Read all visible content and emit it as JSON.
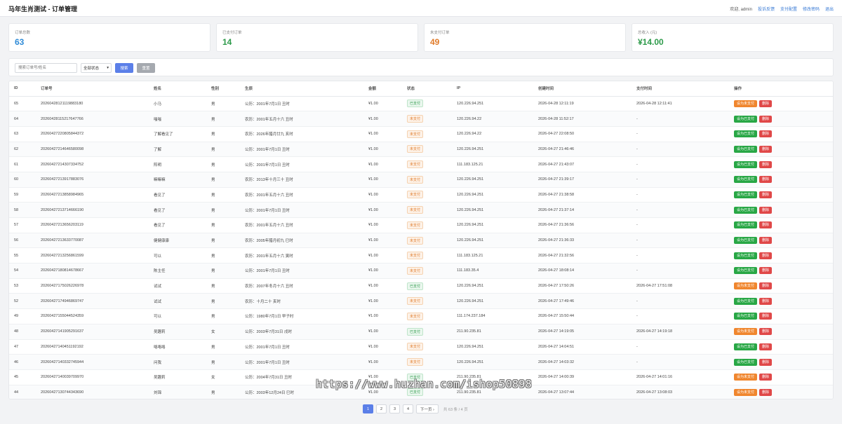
{
  "header": {
    "title": "马年生肖测试 - 订单管理",
    "welcome": "欢迎, admin",
    "links": [
      "投诉反馈",
      "支付配置",
      "修改密码",
      "退出"
    ]
  },
  "stats": [
    {
      "label": "订单总数",
      "value": "63",
      "color": "#2f8bd7"
    },
    {
      "label": "已支付订单",
      "value": "14",
      "color": "#2d9a4a"
    },
    {
      "label": "未支付订单",
      "value": "49",
      "color": "#e07b2a"
    },
    {
      "label": "总收入 (元)",
      "value": "¥14.00",
      "color": "#2d9a4a"
    }
  ],
  "filter": {
    "search_placeholder": "搜索订单号/姓名",
    "status_value": "全部状态",
    "search_label": "搜索",
    "reset_label": "重置"
  },
  "table": {
    "columns": [
      "ID",
      "订单号",
      "姓名",
      "性别",
      "生辰",
      "金额",
      "状态",
      "IP",
      "创建时间",
      "支付时间",
      "操作"
    ],
    "rows": [
      {
        "id": "65",
        "order": "20260428121119883180",
        "name": "小马",
        "gender": "男",
        "birth": "公历：2001年7月1日 丑时",
        "amount": "¥1.00",
        "status": "已支付",
        "paid": true,
        "ip": "120.226.94.251",
        "created": "2026-04-28 12:11:19",
        "paytime": "2026-04-28 12:11:41",
        "action": "设为未支付",
        "del": "删除"
      },
      {
        "id": "64",
        "order": "20260428115217647766",
        "name": "嗤嗤",
        "gender": "男",
        "birth": "农历：2001年五月十六 丑时",
        "amount": "¥1.00",
        "status": "未支付",
        "paid": false,
        "ip": "120.226.94.22",
        "created": "2026-04-28 11:52:17",
        "paytime": "-",
        "action": "设为已支付",
        "del": "删除"
      },
      {
        "id": "63",
        "order": "20260427220805844372",
        "name": "了解看见了",
        "gender": "男",
        "birth": "农历：2026年腊月廿九 亥时",
        "amount": "¥1.00",
        "status": "未支付",
        "paid": false,
        "ip": "120.226.94.22",
        "created": "2026-04-27 22:08:50",
        "paytime": "-",
        "action": "设为已支付",
        "del": "删除"
      },
      {
        "id": "62",
        "order": "20260427214646580098",
        "name": "了解",
        "gender": "男",
        "birth": "公历：2001年7月1日 丑时",
        "amount": "¥1.00",
        "status": "未支付",
        "paid": false,
        "ip": "120.226.94.251",
        "created": "2026-04-27 21:46:46",
        "paytime": "-",
        "action": "设为已支付",
        "del": "删除"
      },
      {
        "id": "61",
        "order": "20260427214307334752",
        "name": "阵明",
        "gender": "男",
        "birth": "公历：2001年7月1日 丑时",
        "amount": "¥1.00",
        "status": "未支付",
        "paid": false,
        "ip": "111.183.125.21",
        "created": "2026-04-27 21:43:07",
        "paytime": "-",
        "action": "设为已支付",
        "del": "删除"
      },
      {
        "id": "60",
        "order": "20260427213917883076",
        "name": "嘛嘛嘛",
        "gender": "男",
        "birth": "农历：2013年十月三十 丑时",
        "amount": "¥1.00",
        "status": "未支付",
        "paid": false,
        "ip": "120.226.94.251",
        "created": "2026-04-27 21:39:17",
        "paytime": "-",
        "action": "设为已支付",
        "del": "删除"
      },
      {
        "id": "59",
        "order": "20260427213858984965",
        "name": "看见了",
        "gender": "男",
        "birth": "农历：2001年五月十六 丑时",
        "amount": "¥1.00",
        "status": "未支付",
        "paid": false,
        "ip": "120.226.94.251",
        "created": "2026-04-27 21:38:58",
        "paytime": "-",
        "action": "设为已支付",
        "del": "删除"
      },
      {
        "id": "58",
        "order": "20260427213714666190",
        "name": "看见了",
        "gender": "男",
        "birth": "公历：2001年7月1日 丑时",
        "amount": "¥1.00",
        "status": "未支付",
        "paid": false,
        "ip": "120.226.94.251",
        "created": "2026-04-27 21:37:14",
        "paytime": "-",
        "action": "设为已支付",
        "del": "删除"
      },
      {
        "id": "57",
        "order": "20260427213656203119",
        "name": "看见了",
        "gender": "男",
        "birth": "农历：2001年五月十六 丑时",
        "amount": "¥1.00",
        "status": "未支付",
        "paid": false,
        "ip": "120.226.94.251",
        "created": "2026-04-27 21:36:56",
        "paytime": "-",
        "action": "设为已支付",
        "del": "删除"
      },
      {
        "id": "56",
        "order": "20260427213633770087",
        "name": "健健康康",
        "gender": "男",
        "birth": "农历：2005年腊月初九 巳时",
        "amount": "¥1.00",
        "status": "未支付",
        "paid": false,
        "ip": "120.226.94.251",
        "created": "2026-04-27 21:36:33",
        "paytime": "-",
        "action": "设为已支付",
        "del": "删除"
      },
      {
        "id": "55",
        "order": "20260427213256861599",
        "name": "可以",
        "gender": "男",
        "birth": "农历：2001年五月十六 寅时",
        "amount": "¥1.00",
        "status": "未支付",
        "paid": false,
        "ip": "111.183.125.21",
        "created": "2026-04-27 21:32:56",
        "paytime": "-",
        "action": "设为已支付",
        "del": "删除"
      },
      {
        "id": "54",
        "order": "20260427180814678667",
        "name": "陈主任",
        "gender": "男",
        "birth": "公历：2001年7月1日 丑时",
        "amount": "¥1.00",
        "status": "未支付",
        "paid": false,
        "ip": "111.183.35.4",
        "created": "2026-04-27 18:08:14",
        "paytime": "-",
        "action": "设为已支付",
        "del": "删除"
      },
      {
        "id": "53",
        "order": "20260427175026226978",
        "name": "试试",
        "gender": "男",
        "birth": "农历：2007年冬月十六 丑时",
        "amount": "¥1.00",
        "status": "已支付",
        "paid": true,
        "ip": "120.226.94.251",
        "created": "2026-04-27 17:50:26",
        "paytime": "2026-04-27 17:51:08",
        "action": "设为未支付",
        "del": "删除"
      },
      {
        "id": "52",
        "order": "20260427174946869747",
        "name": "试试",
        "gender": "男",
        "birth": "农历：十月二十 亥时",
        "amount": "¥1.00",
        "status": "未支付",
        "paid": false,
        "ip": "120.226.94.251",
        "created": "2026-04-27 17:49:46",
        "paytime": "-",
        "action": "设为已支付",
        "del": "删除"
      },
      {
        "id": "49",
        "order": "20260427155044524359",
        "name": "可以",
        "gender": "男",
        "birth": "公历：1980年7月1日 早子时",
        "amount": "¥1.00",
        "status": "未支付",
        "paid": false,
        "ip": "111.174.237.184",
        "created": "2026-04-27 15:50:44",
        "paytime": "-",
        "action": "设为已支付",
        "del": "删除"
      },
      {
        "id": "48",
        "order": "20260427141905291637",
        "name": "吴趣莉",
        "gender": "女",
        "birth": "公历：2003年7月31日 戌时",
        "amount": "¥1.00",
        "status": "已支付",
        "paid": true,
        "ip": "211.90.235.81",
        "created": "2026-04-27 14:19:05",
        "paytime": "2026-04-27 14:19:18",
        "action": "设为未支付",
        "del": "删除"
      },
      {
        "id": "47",
        "order": "20260427140451192192",
        "name": "咯咯咯",
        "gender": "男",
        "birth": "公历：2001年7月1日 丑时",
        "amount": "¥1.00",
        "status": "未支付",
        "paid": false,
        "ip": "120.226.94.251",
        "created": "2026-04-27 14:04:51",
        "paytime": "-",
        "action": "设为已支付",
        "del": "删除"
      },
      {
        "id": "46",
        "order": "20260427140332745944",
        "name": "问我",
        "gender": "男",
        "birth": "公历：2001年7月1日 丑时",
        "amount": "¥1.00",
        "status": "未支付",
        "paid": false,
        "ip": "120.226.94.251",
        "created": "2026-04-27 14:03:32",
        "paytime": "-",
        "action": "设为已支付",
        "del": "删除"
      },
      {
        "id": "45",
        "order": "20260427140039709970",
        "name": "吴趣莉",
        "gender": "女",
        "birth": "公历：2004年7月31日 丑时",
        "amount": "¥1.00",
        "status": "已支付",
        "paid": true,
        "ip": "211.90.235.81",
        "created": "2026-04-27 14:00:39",
        "paytime": "2026-04-27 14:01:16",
        "action": "设为未支付",
        "del": "删除"
      },
      {
        "id": "44",
        "order": "20260427130744343690",
        "name": "刘锦",
        "gender": "男",
        "birth": "公历：2003年12月24日 巳时",
        "amount": "¥1.00",
        "status": "已支付",
        "paid": true,
        "ip": "211.90.235.81",
        "created": "2026-04-27 13:07:44",
        "paytime": "2026-04-27 13:08:03",
        "action": "设为未支付",
        "del": "删除"
      }
    ]
  },
  "pagination": {
    "pages": [
      "1",
      "2",
      "3",
      "4"
    ],
    "active": "1",
    "next_label": "下一页 ›",
    "info": "共 63 条 / 4 页"
  },
  "watermark": "https://www.huzhan.com/ishop50898"
}
